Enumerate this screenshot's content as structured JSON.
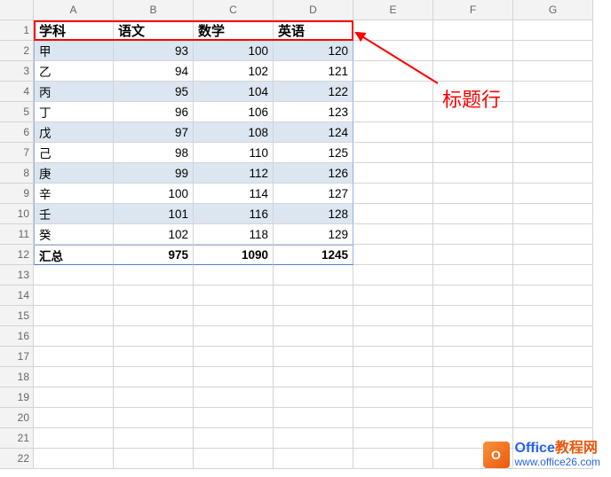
{
  "columns": [
    "A",
    "B",
    "C",
    "D",
    "E",
    "F",
    "G"
  ],
  "row_numbers": [
    1,
    2,
    3,
    4,
    5,
    6,
    7,
    8,
    9,
    10,
    11,
    12,
    13,
    14,
    15,
    16,
    17,
    18,
    19,
    20,
    21,
    22
  ],
  "headers": [
    "学科",
    "语文",
    "数学",
    "英语"
  ],
  "rows": [
    {
      "name": "甲",
      "v": [
        93,
        100,
        120
      ]
    },
    {
      "name": "乙",
      "v": [
        94,
        102,
        121
      ]
    },
    {
      "name": "丙",
      "v": [
        95,
        104,
        122
      ]
    },
    {
      "name": "丁",
      "v": [
        96,
        106,
        123
      ]
    },
    {
      "name": "戊",
      "v": [
        97,
        108,
        124
      ]
    },
    {
      "name": "己",
      "v": [
        98,
        110,
        125
      ]
    },
    {
      "name": "庚",
      "v": [
        99,
        112,
        126
      ]
    },
    {
      "name": "辛",
      "v": [
        100,
        114,
        127
      ]
    },
    {
      "name": "壬",
      "v": [
        101,
        116,
        128
      ]
    },
    {
      "name": "癸",
      "v": [
        102,
        118,
        129
      ]
    }
  ],
  "totals": {
    "label": "汇总",
    "v": [
      975,
      1090,
      1245
    ]
  },
  "annotation": "标题行",
  "watermark": {
    "title1": "Office",
    "title2": "教程网",
    "url": "www.office26.com"
  }
}
